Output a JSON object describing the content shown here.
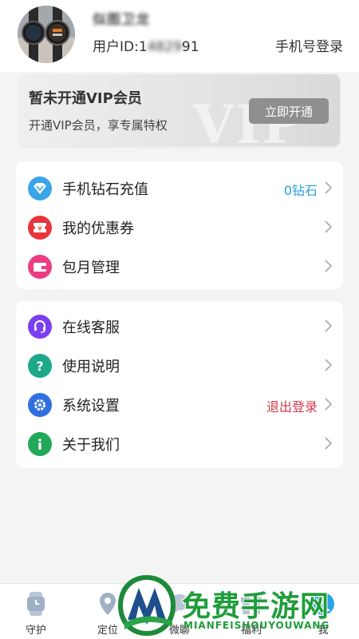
{
  "profile": {
    "nickname": "似图卫龙",
    "uid_label": "用户ID:1",
    "uid_masked": "4829",
    "uid_tail": "91",
    "phone_login": "手机号登录"
  },
  "vip": {
    "title": "暂未开通VIP会员",
    "subtitle": "开通VIP会员，享专属特权",
    "button": "立即开通",
    "watermark": "VIP"
  },
  "menu_group_1": [
    {
      "label": "手机钻石充值",
      "value": "0钻石",
      "icon": "diamond-icon",
      "color": "#3aa5e8",
      "value_color": "#2a9fe0"
    },
    {
      "label": "我的优惠券",
      "value": "",
      "icon": "coupon-icon",
      "color": "#e8343c"
    },
    {
      "label": "包月管理",
      "value": "",
      "icon": "wallet-icon",
      "color": "#ec3d80"
    }
  ],
  "menu_group_2": [
    {
      "label": "在线客服",
      "value": "",
      "icon": "headset-icon",
      "color": "#7b3ff2"
    },
    {
      "label": "使用说明",
      "value": "",
      "icon": "question-icon",
      "color": "#1ea88a"
    },
    {
      "label": "系统设置",
      "value": "退出登录",
      "icon": "gear-icon",
      "color": "#2f6fe0",
      "value_color": "#d2384a"
    },
    {
      "label": "关于我们",
      "value": "",
      "icon": "info-icon",
      "color": "#22a85a"
    }
  ],
  "tabs": [
    {
      "label": "守护",
      "icon": "watch-icon"
    },
    {
      "label": "定位",
      "icon": "location-icon"
    },
    {
      "label": "微聊",
      "icon": "chat-icon"
    },
    {
      "label": "福利",
      "icon": "gift-icon"
    },
    {
      "label": "我",
      "icon": "user-icon"
    }
  ],
  "watermark": {
    "text": "免费手游网",
    "sub": "MIANFEISHOUYOUWANG"
  }
}
